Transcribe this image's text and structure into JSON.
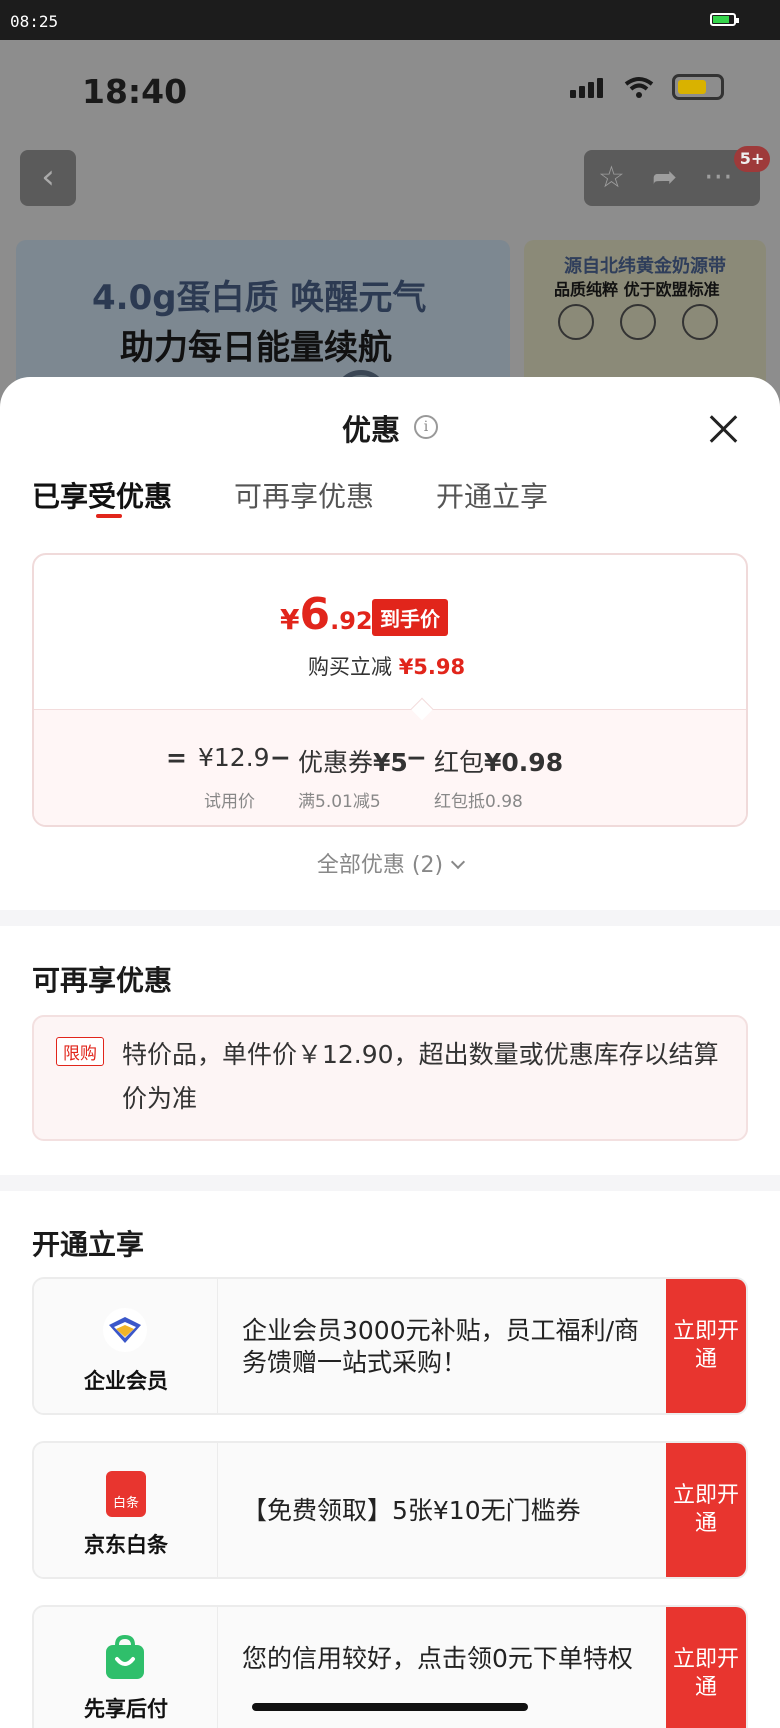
{
  "status_bar": {
    "time": "08:25"
  },
  "background_page": {
    "phone_time": "18:40",
    "badge": "5+",
    "banner_left": {
      "line1": "4.0g蛋白质 唤醒元气",
      "line2": "助力每日能量续航"
    },
    "banner_right": {
      "line1": "源自北纬黄金奶源带",
      "line2": "品质纯粹 优于欧盟标准"
    }
  },
  "sheet": {
    "title": "优惠",
    "tabs": [
      {
        "label": "已享受优惠",
        "active": true
      },
      {
        "label": "可再享优惠",
        "active": false
      },
      {
        "label": "开通立享",
        "active": false
      }
    ],
    "price_card": {
      "currency": "¥",
      "final_int": "6",
      "final_dec": ".92",
      "final_tag": "到手价",
      "reduce_label": "购买立减",
      "reduce_amount": "¥5.98",
      "eq_sign": "=",
      "trial_price": "¥12.9",
      "minus1": "−",
      "coupon_label": "优惠券",
      "coupon_amount": "¥5",
      "minus2": "−",
      "red_label": "红包",
      "red_amount": "¥0.98",
      "trial_sub": "试用价",
      "coupon_sub": "满5.01减5",
      "red_sub": "红包抵0.98"
    },
    "all_offers": "全部优惠 (2)",
    "more_offers": {
      "title": "可再享优惠",
      "limit_tag": "限购",
      "limit_text": "特价品，单件价￥12.90，超出数量或优惠库存以结算价为准"
    },
    "open_enjoy": {
      "title": "开通立享",
      "services": [
        {
          "name": "企业会员",
          "desc": "企业会员3000元补贴，员工福利/商务馈赠一站式采购！",
          "cta": "立即开通",
          "icon": "enterprise-member-icon"
        },
        {
          "name": "京东白条",
          "desc": "【免费领取】5张¥10无门槛券",
          "cta": "立即开通",
          "icon": "jd-baitiao-icon",
          "icon_text": "白条"
        },
        {
          "name": "先享后付",
          "desc": "您的信用较好，点击领0元下单特权",
          "cta": "立即开通",
          "icon": "pay-later-icon"
        }
      ]
    }
  },
  "colors": {
    "accent": "#e1251b",
    "cta": "#e8352f"
  }
}
